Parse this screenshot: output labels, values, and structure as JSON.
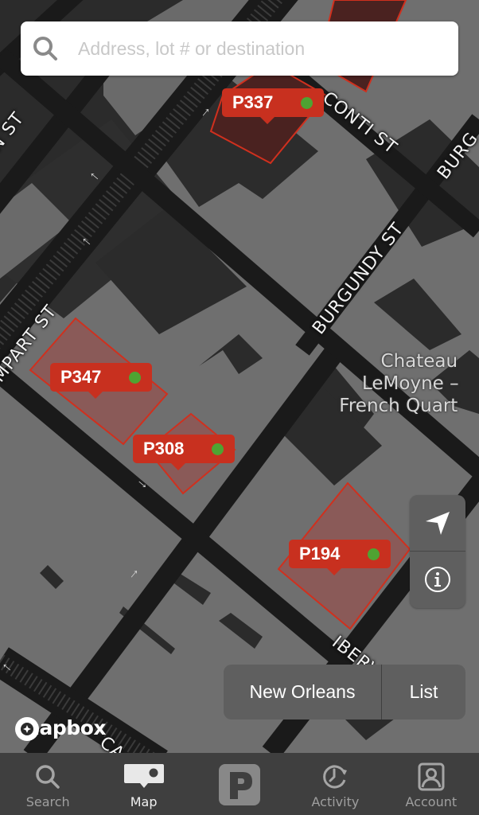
{
  "search": {
    "placeholder": "Address, lot # or destination",
    "value": "",
    "icon": "search-icon"
  },
  "map": {
    "colors": {
      "block": "#707070",
      "building": "#2b2b2b",
      "road": "#1a1a1a",
      "lot_fill": "#8a5a58",
      "lot_fill_dark": "#4a2220",
      "lot_stroke": "#d0301e",
      "marker": "#c8301f",
      "available_dot": "#4fa332"
    },
    "street_labels": [
      {
        "text": "CONTI ST"
      },
      {
        "text": "BURGUNDY ST"
      },
      {
        "text": "BURG"
      },
      {
        "text": "MPART ST"
      },
      {
        "text": "N ST"
      },
      {
        "text": "IBERV"
      },
      {
        "text": "CA"
      }
    ],
    "poi": {
      "lines": [
        "Chateau",
        "LeMoyne –",
        "French Quart"
      ]
    },
    "lots": [
      {
        "code": "P337",
        "available": true
      },
      {
        "code": "P347",
        "available": true
      },
      {
        "code": "P308",
        "available": true
      },
      {
        "code": "P194",
        "available": true
      }
    ],
    "attribution": "mapbox"
  },
  "controls": {
    "locate_icon": "location-arrow-icon",
    "info_icon": "info-icon"
  },
  "segmented": {
    "options": [
      "New Orleans",
      "List"
    ]
  },
  "tabbar": {
    "items": [
      {
        "label": "Search",
        "icon": "search-icon",
        "active": false
      },
      {
        "label": "Map",
        "icon": "map-pin-icon",
        "active": true
      },
      {
        "label": "",
        "icon": "parking-icon",
        "active": false
      },
      {
        "label": "Activity",
        "icon": "history-clock-icon",
        "active": false
      },
      {
        "label": "Account",
        "icon": "account-icon",
        "active": false
      }
    ]
  }
}
